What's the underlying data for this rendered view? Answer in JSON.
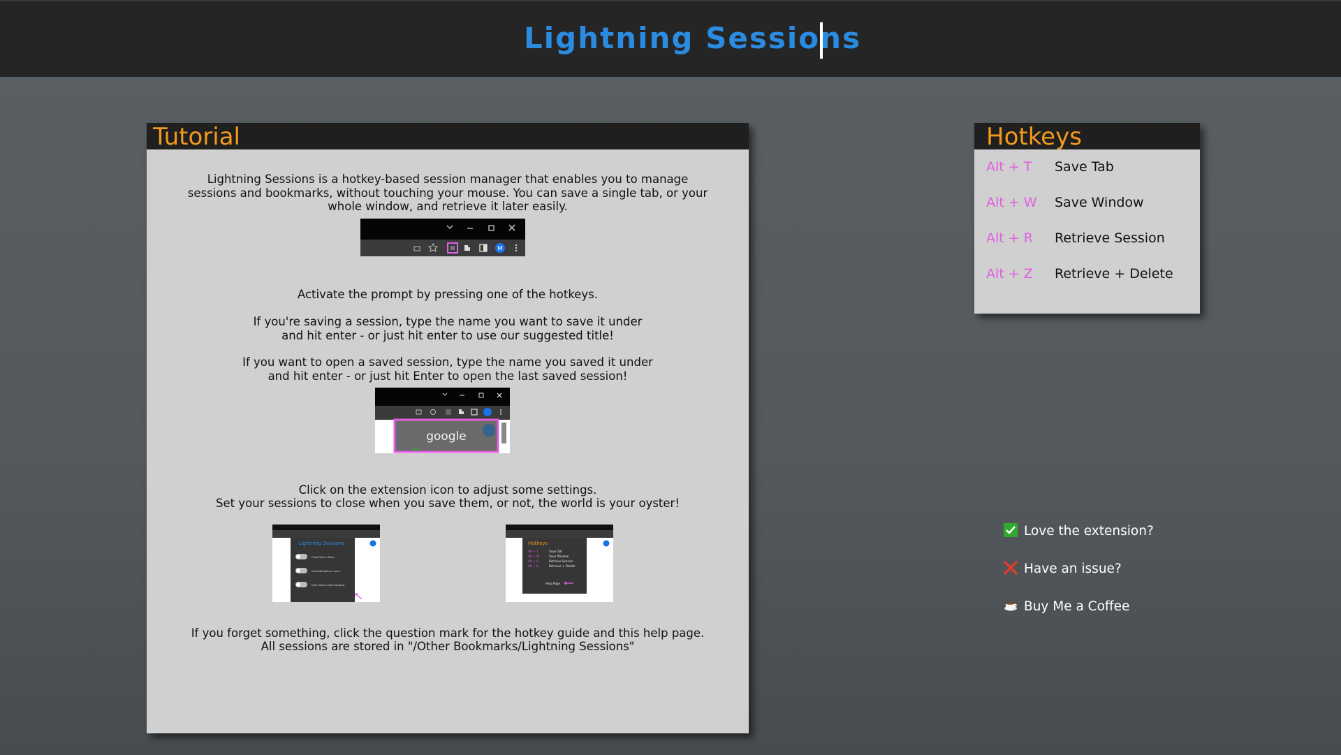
{
  "header": {
    "title": "Lightning Sessions"
  },
  "tutorial": {
    "heading": "Tutorial",
    "intro": "Lightning Sessions is a hotkey-based session manager that enables you to manage sessions and bookmarks, without touching your mouse. You can save a single tab, or your whole window, and retrieve it later easily.",
    "activate": "Activate the prompt by pressing one of the hotkeys.",
    "saving": "If you're saving a session, type the name you want to save it under and hit enter - or just hit enter to use our suggested title!",
    "opening": "If you want to open a saved session, type the name you saved it under and hit enter - or just hit Enter to open the last saved session!",
    "settings_line1": "Click on the extension icon to adjust some settings.",
    "settings_line2": "Set your sessions to close when you save them, or not, the world is your oyster!",
    "forget_line1": "If you forget something, click the question mark for the hotkey guide and this help page.",
    "forget_line2": "All sessions are stored in \"/Other Bookmarks/Lightning Sessions\"",
    "shot2_text": "google",
    "shot3": {
      "title": "Lightning Sessions",
      "options": [
        "Close Tab on Save",
        "Close Window on Save",
        "Open Tabs in New Window"
      ]
    },
    "shot4": {
      "title": "Hotkeys",
      "rows": [
        {
          "key": "Alt + T",
          "action": "Save Tab"
        },
        {
          "key": "Alt + W",
          "action": "Save Window"
        },
        {
          "key": "Alt + R",
          "action": "Retrieve Session"
        },
        {
          "key": "Alt + Z",
          "action": "Retrieve + Delete"
        }
      ],
      "help": "Help Page"
    },
    "avatar_letter": "M"
  },
  "hotkeys": {
    "heading": "Hotkeys",
    "rows": [
      {
        "key": "Alt + T",
        "action": "Save Tab"
      },
      {
        "key": "Alt + W",
        "action": "Save Window"
      },
      {
        "key": "Alt + R",
        "action": "Retrieve Session"
      },
      {
        "key": "Alt + Z",
        "action": "Retrieve + Delete"
      }
    ]
  },
  "links": [
    {
      "label": "Love the extension?",
      "icon": "check-box-icon"
    },
    {
      "label": "Have an issue?",
      "icon": "red-x-icon"
    },
    {
      "label": "Buy Me a Coffee",
      "icon": "coffee-cup-icon"
    }
  ],
  "colors": {
    "title_blue": "#2a8be0",
    "heading_orange": "#f39a1d",
    "hotkey_pink": "#e15fe0",
    "header_bg": "#252525"
  }
}
